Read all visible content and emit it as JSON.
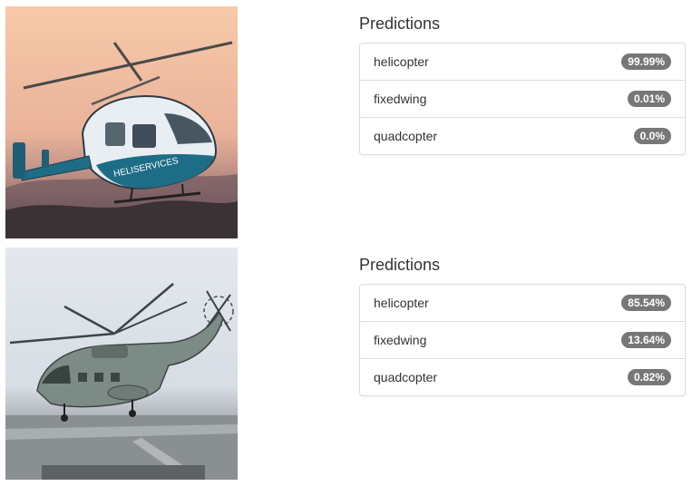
{
  "results": [
    {
      "image_alt": "helicopter photo at sunset",
      "title": "Predictions",
      "predictions": [
        {
          "label": "helicopter",
          "value": "99.99%"
        },
        {
          "label": "fixedwing",
          "value": "0.01%"
        },
        {
          "label": "quadcopter",
          "value": "0.0%"
        }
      ]
    },
    {
      "image_alt": "military helicopter photo over airfield",
      "title": "Predictions",
      "predictions": [
        {
          "label": "helicopter",
          "value": "85.54%"
        },
        {
          "label": "fixedwing",
          "value": "13.64%"
        },
        {
          "label": "quadcopter",
          "value": "0.82%"
        }
      ]
    }
  ],
  "colors": {
    "badge_bg": "#777777",
    "badge_text": "#ffffff",
    "border": "#dddddd",
    "text": "#333333"
  }
}
